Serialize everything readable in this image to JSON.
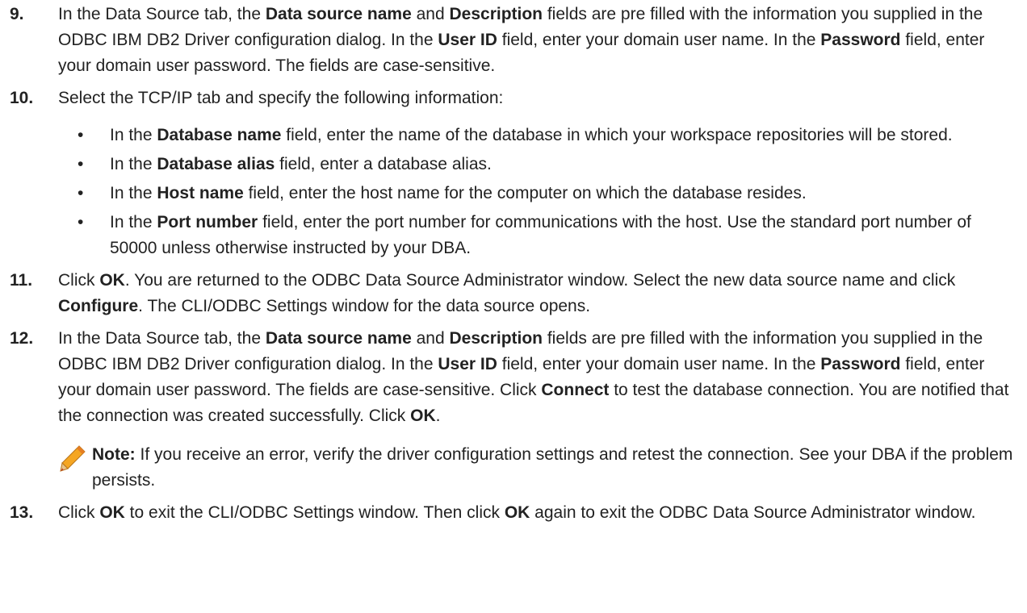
{
  "steps": [
    {
      "number": "9.",
      "t1": "In the Data Source tab, the ",
      "b1": "Data source name",
      "t2": " and ",
      "b2": "Description",
      "t3": " fields are pre filled with the information you supplied in the ODBC IBM DB2 Driver configuration dialog. In the ",
      "b3": "User ID",
      "t4": " field, enter your domain user name. In the ",
      "b4": "Password",
      "t5": " field, enter your domain user password. The fields are case-sensitive."
    },
    {
      "number": "10.",
      "text": "Select the TCP/IP tab and specify the following information:",
      "bullets": [
        {
          "pre": "In the ",
          "bold": "Database name",
          "post": " field, enter the name of the database in which your workspace repositories will be stored."
        },
        {
          "pre": "In the ",
          "bold": "Database alias",
          "post": " field, enter a database alias."
        },
        {
          "pre": "In the ",
          "bold": "Host name",
          "post": " field, enter the host name for the computer on which the database resides."
        },
        {
          "pre": "In the ",
          "bold": "Port number",
          "post": " field, enter the port number for communications with the host. Use the standard port number of 50000 unless otherwise instructed by your DBA."
        }
      ]
    },
    {
      "number": "11.",
      "t1": "Click ",
      "b1": "OK",
      "t2": ". You are returned to the ODBC Data Source Administrator window. Select the new data source name and click ",
      "b2": "Configure",
      "t3": ". The CLI/ODBC Settings window for the data source opens."
    },
    {
      "number": "12.",
      "t1": "In the Data Source tab, the ",
      "b1": "Data source name",
      "t2": " and ",
      "b2": "Description",
      "t3": " fields are pre filled with the information you supplied in the ODBC IBM DB2 Driver configuration dialog. In the ",
      "b3": "User ID",
      "t4": " field, enter your domain user name. In the ",
      "b4": "Password",
      "t5": " field, enter your domain user password. The fields are case-sensitive. Click ",
      "b5": "Connect",
      "t6": " to test the database connection. You are notified that the connection was created successfully. Click ",
      "b6": "OK",
      "t7": ".",
      "note": {
        "label": "Note:",
        "text": " If you receive an error, verify the driver configuration settings and retest the connection. See your DBA if the problem persists."
      }
    },
    {
      "number": "13.",
      "t1": "Click ",
      "b1": "OK",
      "t2": " to exit the CLI/ODBC Settings window. Then click ",
      "b2": "OK",
      "t3": " again to exit the ODBC Data Source Administrator window."
    }
  ],
  "colors": {
    "text": "#222222",
    "pencil_body": "#f5a623",
    "pencil_tip": "#c0392b"
  },
  "icons": {
    "note": "pencil-icon"
  }
}
